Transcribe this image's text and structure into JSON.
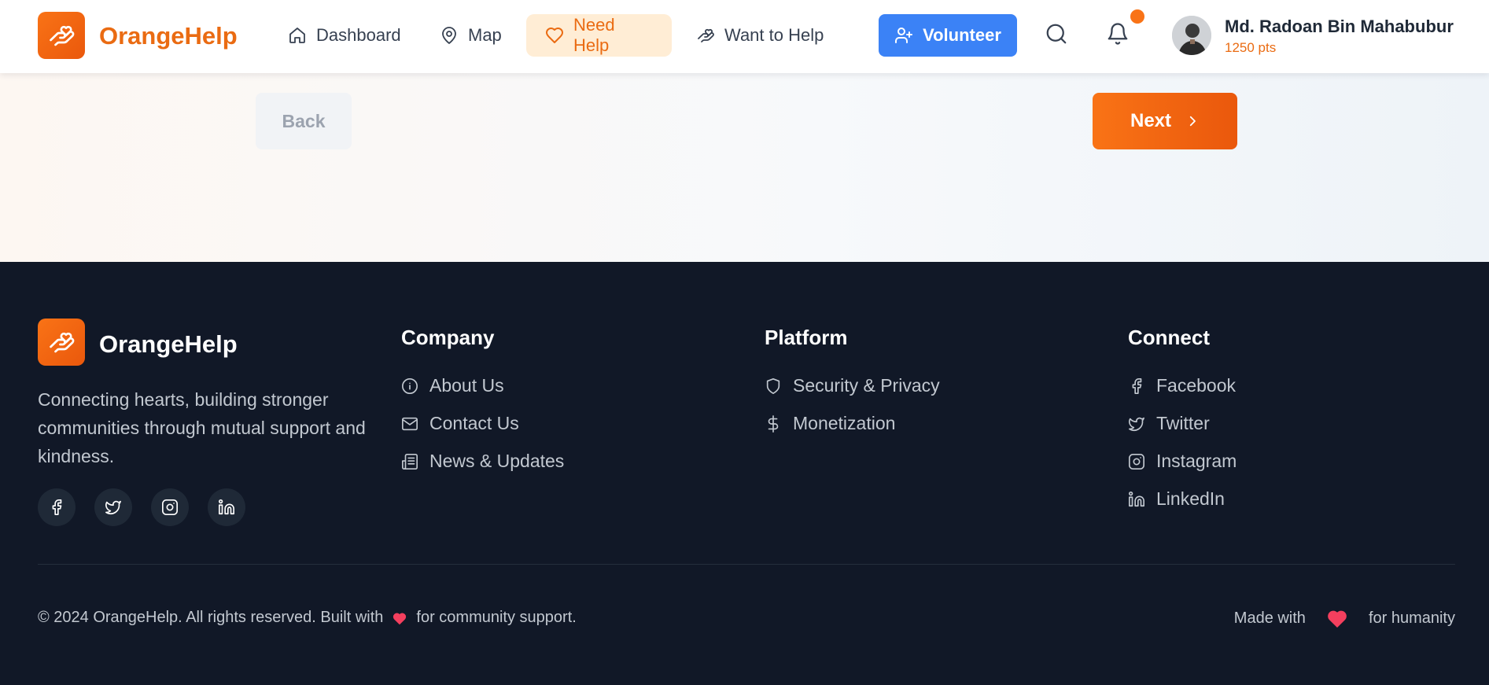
{
  "colors": {
    "brand": "#f97316",
    "brand_dark": "#ea580c",
    "volunteer_blue": "#3b82f6",
    "footer_bg": "#111827",
    "heart": "#f43f5e"
  },
  "nav": {
    "brand": "OrangeHelp",
    "items": [
      {
        "label": "Dashboard",
        "icon": "home-icon"
      },
      {
        "label": "Map",
        "icon": "map-pin-icon"
      },
      {
        "label": "Need Help",
        "icon": "heart-icon",
        "active": true
      },
      {
        "label": "Want to Help",
        "icon": "hand-heart-icon"
      }
    ],
    "volunteer_label": "Volunteer",
    "notification_dot": true,
    "user": {
      "name": "Md. Radoan Bin Mahabubur",
      "points": "1250 pts"
    }
  },
  "main": {
    "back_label": "Back",
    "next_label": "Next"
  },
  "footer": {
    "brand": "OrangeHelp",
    "tagline": "Connecting hearts, building stronger communities through mutual support and kindness.",
    "social_icons": [
      "facebook-icon",
      "twitter-icon",
      "instagram-icon",
      "linkedin-icon"
    ],
    "company": {
      "title": "Company",
      "links": [
        {
          "label": "About Us",
          "icon": "info-icon"
        },
        {
          "label": "Contact Us",
          "icon": "mail-icon"
        },
        {
          "label": "News & Updates",
          "icon": "newspaper-icon"
        }
      ]
    },
    "platform": {
      "title": "Platform",
      "links": [
        {
          "label": "Security & Privacy",
          "icon": "shield-icon"
        },
        {
          "label": "Monetization",
          "icon": "dollar-icon"
        }
      ]
    },
    "connect": {
      "title": "Connect",
      "links": [
        {
          "label": "Facebook",
          "icon": "facebook-icon"
        },
        {
          "label": "Twitter",
          "icon": "twitter-icon"
        },
        {
          "label": "Instagram",
          "icon": "instagram-icon"
        },
        {
          "label": "LinkedIn",
          "icon": "linkedin-icon"
        }
      ]
    },
    "copyright_before": "© 2024 OrangeHelp. All rights reserved. Built with",
    "copyright_after": "for community support.",
    "made_with_before": "Made with",
    "made_with_after": "for humanity"
  }
}
